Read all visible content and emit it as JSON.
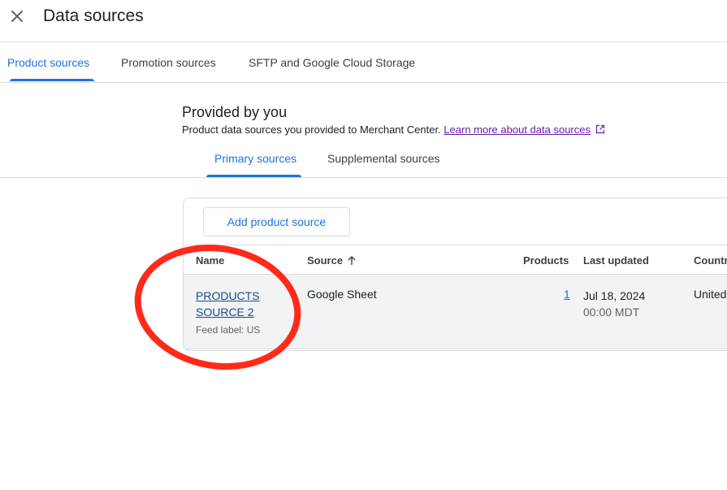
{
  "header": {
    "title": "Data sources"
  },
  "main_tabs": [
    {
      "label": "Product sources",
      "active": true
    },
    {
      "label": "Promotion sources",
      "active": false
    },
    {
      "label": "SFTP and Google Cloud Storage",
      "active": false
    }
  ],
  "section": {
    "title": "Provided by you",
    "description": "Product data sources you provided to Merchant Center.",
    "learn_more_link": "Learn more about data sources"
  },
  "sub_tabs": [
    {
      "label": "Primary sources",
      "active": true
    },
    {
      "label": "Supplemental sources",
      "active": false
    }
  ],
  "card": {
    "add_button_label": "Add product source",
    "columns": {
      "name": "Name",
      "source": "Source",
      "products": "Products",
      "last_updated": "Last updated",
      "country": "Countr"
    },
    "rows": [
      {
        "name_line1": "PRODUCTS",
        "name_line2": "SOURCE 2",
        "feed_label": "Feed label: US",
        "source": "Google Sheet",
        "products": "1",
        "last_updated_date": "Jul 18, 2024",
        "last_updated_time": "00:00 MDT",
        "country": "United"
      }
    ]
  },
  "colors": {
    "accent": "#1a73e8",
    "link_visited": "#681da8",
    "annotation": "#ff2a1a",
    "row_bg": "#f1f3f4",
    "divider": "#dadce0"
  },
  "icons": {
    "close": "close-icon",
    "external_link": "external-link-icon",
    "sort": "arrow-up-icon"
  }
}
